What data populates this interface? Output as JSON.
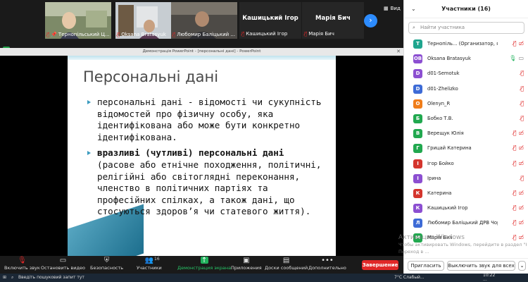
{
  "thumbnails": [
    {
      "name": "Тернопільський Ц...",
      "pinned": true
    },
    {
      "name": "Oksana Bratasyuk",
      "pinned": false
    },
    {
      "name": "Любомир Баліцький ...",
      "pinned": false
    }
  ],
  "named_tiles": [
    {
      "big": "Кашицький Ігор",
      "label": "Кашицький Ігор"
    },
    {
      "big": "Марія Бич",
      "label": "Марія Бич"
    }
  ],
  "view_label": "Вид",
  "ppt_title": "Демонстрація PowerPoint - [персональні дані] - PowerPoint",
  "slide": {
    "title": "Персональні дані",
    "bullet1": "персональні дані - відомості чи сукупність відомостей про фізичну особу, яка ідентифікована або може бути конкретно ідентифікована.",
    "bullet2_bold": "вразливі (чутливі) персональні дані",
    "bullet2_rest": " (расове або етнічне походження, політичні, релігійні або світоглядні переконання, членство в політичних партіях та професійних спілках, а також дані, що стосуються здоров’я чи статевого життя)."
  },
  "toolbar": {
    "unmute": "Включить звук",
    "stop_video": "Остановить видео",
    "security": "Безопасность",
    "participants": "Участники",
    "participants_count": "16",
    "share": "Демонстрация экрана",
    "apps": "Приложения",
    "whiteboards": "Доски сообщений",
    "more": "Дополнительно",
    "end": "Завершение"
  },
  "panel": {
    "title": "Участники (16)",
    "search_placeholder": "Найти участника",
    "invite": "Пригласить",
    "mute_all": "Выключить звук для всех"
  },
  "participants": [
    {
      "initial": "Т",
      "color": "#1fa58e",
      "name": "Тернопіль... (Организатор, я)",
      "mic": "muted",
      "video": "off"
    },
    {
      "initial": "OB",
      "color": "#8c4fd1",
      "name": "Oksana Bratasyuk",
      "mic": "on",
      "video": "on"
    },
    {
      "initial": "D",
      "color": "#8c4fd1",
      "name": "d01-Semotuk",
      "mic": "muted",
      "video": "none"
    },
    {
      "initial": "D",
      "color": "#3d6bd6",
      "name": "d01-Zhelizko",
      "mic": "muted",
      "video": "none"
    },
    {
      "initial": "O",
      "color": "#f07d1a",
      "name": "Olenyn_R",
      "mic": "muted",
      "video": "none"
    },
    {
      "initial": "Б",
      "color": "#21a84f",
      "name": "Бобко Т.В.",
      "mic": "muted",
      "video": "none"
    },
    {
      "initial": "В",
      "color": "#21a84f",
      "name": "Верещук Юлія",
      "mic": "muted",
      "video": "off"
    },
    {
      "initial": "Г",
      "color": "#21a84f",
      "name": "Грицай Катерина",
      "mic": "muted",
      "video": "off"
    },
    {
      "initial": "І",
      "color": "#d4352d",
      "name": "Ігор Бойко",
      "mic": "muted",
      "video": "off"
    },
    {
      "initial": "І",
      "color": "#8c4fd1",
      "name": "Ірина",
      "mic": "muted",
      "video": "none"
    },
    {
      "initial": "К",
      "color": "#d4352d",
      "name": "Катерина",
      "mic": "muted",
      "video": "off"
    },
    {
      "initial": "К",
      "color": "#8c4fd1",
      "name": "Кашицький Ігор",
      "mic": "muted",
      "video": "off"
    },
    {
      "initial": "Л",
      "color": "#3d6bd6",
      "name": "Любомир Баліцький ДРВ Чор...",
      "mic": "muted",
      "video": "off"
    },
    {
      "initial": "М",
      "color": "#21a84f",
      "name": "Марія Бич",
      "mic": "muted",
      "video": "off"
    }
  ],
  "watermark": {
    "line1": "Активация Windows",
    "line2": "Чтобы активировать Windows, перейдите в раздел \"Настройки\".",
    "line3": "Переход в ..."
  },
  "taskbar": {
    "search": "Введіть пошуковий запит тут",
    "weather": "7°C Слабый...",
    "time": "10:22",
    "date": "..."
  }
}
